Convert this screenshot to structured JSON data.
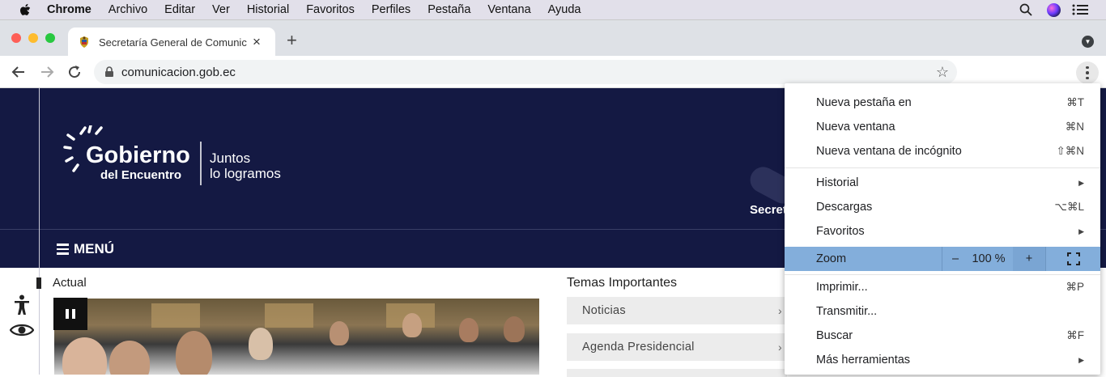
{
  "menubar": {
    "items": [
      "Chrome",
      "Archivo",
      "Editar",
      "Ver",
      "Historial",
      "Favoritos",
      "Perfiles",
      "Pestaña",
      "Ventana",
      "Ayuda"
    ]
  },
  "tab": {
    "title": "Secretaría General de Comunic",
    "close": "×"
  },
  "new_tab": "+",
  "address": {
    "url": "comunicacion.gob.ec"
  },
  "site": {
    "logo_main": "Gobierno",
    "logo_sub": "del Encuentro",
    "slogan_line1": "Juntos",
    "slogan_line2": "lo logramos",
    "hero_peek": "Secret",
    "menu_label": "MENÚ",
    "actual_label": "Actual",
    "temas_title": "Temas Importantes",
    "temas": [
      "Noticias",
      "Agenda Presidencial"
    ],
    "tema_chevron": "›"
  },
  "chrome_menu": {
    "items": [
      {
        "label": "Nueva pestaña en",
        "shortcut": "⌘T"
      },
      {
        "label": "Nueva ventana",
        "shortcut": "⌘N"
      },
      {
        "label": "Nueva ventana de incógnito",
        "shortcut": "⇧⌘N"
      },
      {
        "label": "Historial",
        "shortcut": "▶"
      },
      {
        "label": "Descargas",
        "shortcut": "⌥⌘L"
      },
      {
        "label": "Favoritos",
        "shortcut": "▶"
      },
      {
        "label": "Imprimir...",
        "shortcut": "⌘P"
      },
      {
        "label": "Transmitir...",
        "shortcut": ""
      },
      {
        "label": "Buscar",
        "shortcut": "⌘F"
      },
      {
        "label": "Más herramientas",
        "shortcut": "▶"
      }
    ],
    "zoom": {
      "label": "Zoom",
      "minus": "–",
      "value": "100 %",
      "plus": "+"
    }
  },
  "colors": {
    "hero_bg": "#141943",
    "zoom_highlight": "#83aedb"
  },
  "icons": [
    "apple-icon",
    "search-icon",
    "siri-icon",
    "control-center-icon",
    "back-icon",
    "forward-icon",
    "reload-icon",
    "lock-icon",
    "star-icon",
    "kebab-icon",
    "accessibility-icon",
    "eye-icon",
    "pause-icon",
    "fullscreen-icon"
  ]
}
